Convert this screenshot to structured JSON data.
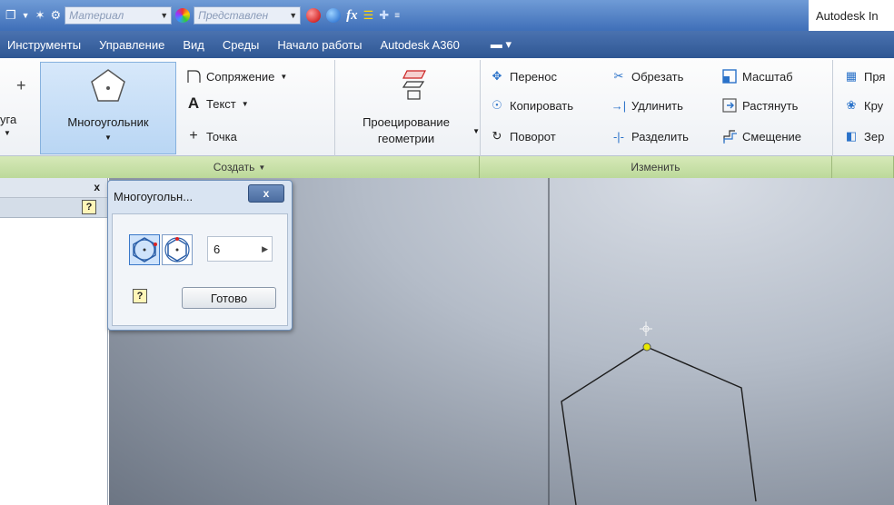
{
  "quick_access": {
    "material_placeholder": "Материал",
    "appearance_placeholder": "Представлен",
    "fx_label": "fx",
    "app_title": "Autodesk In"
  },
  "menu_tabs": [
    "Инструменты",
    "Управление",
    "Вид",
    "Среды",
    "Начало работы",
    "Autodesk A360"
  ],
  "ribbon": {
    "arc_label": "уга",
    "polygon_label": "Многоугольник",
    "fillet_label": "Сопряжение",
    "text_label": "Текст",
    "point_label": "Точка",
    "project_geometry_line1": "Проецирование",
    "project_geometry_line2": "геометрии",
    "move_label": "Перенос",
    "copy_label": "Копировать",
    "rotate_label": "Поворот",
    "trim_label": "Обрезать",
    "extend_label": "Удлинить",
    "split_label": "Разделить",
    "scale_label": "Масштаб",
    "stretch_label": "Растянуть",
    "offset_label": "Смещение",
    "rect_label": "Пря",
    "circle_label": "Кру",
    "mirror_label": "Зер",
    "create_panel": "Создать",
    "modify_panel": "Изменить"
  },
  "dialog": {
    "title": "Многоугольн...",
    "sides_value": "6",
    "done_label": "Готово",
    "help_label": "?",
    "close_label": "x"
  },
  "browser": {
    "close_label": "x",
    "help_label": "?"
  },
  "colors": {
    "accent": "#2f5793",
    "ribbon_panel_label": "#bcd99a",
    "endpoint_marker": "#e8e800"
  }
}
